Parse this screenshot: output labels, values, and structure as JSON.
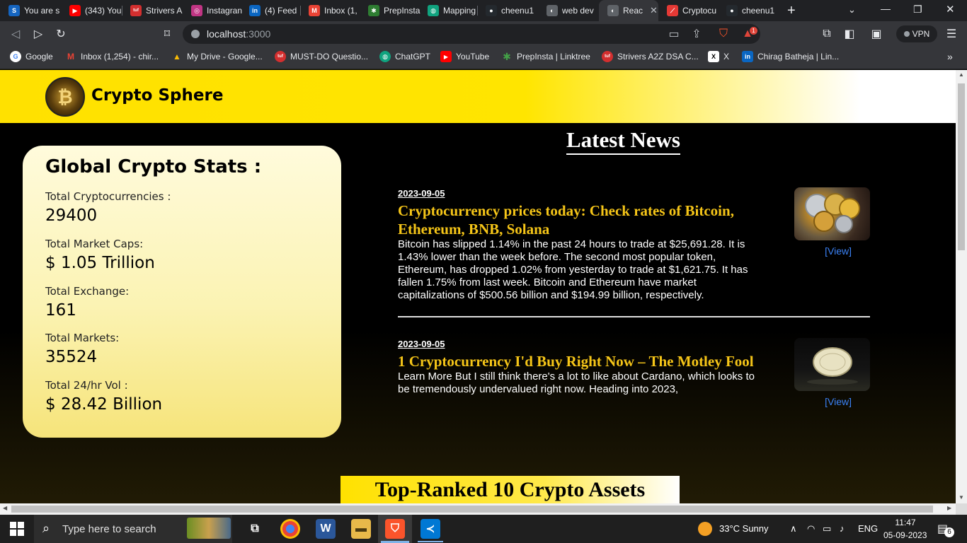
{
  "browser": {
    "tabs": [
      {
        "label": "You are s",
        "icon": "s-icon",
        "color": "#1565c0",
        "glyph": "S"
      },
      {
        "label": "(343) You",
        "icon": "youtube-icon",
        "color": "#ff0000",
        "glyph": "▶"
      },
      {
        "label": "Strivers A",
        "icon": "tuf-icon",
        "color": "#d32f2f",
        "glyph": "tuf"
      },
      {
        "label": "Instagran",
        "icon": "instagram-icon",
        "color": "#c13584",
        "glyph": "◎"
      },
      {
        "label": "(4) Feed",
        "icon": "linkedin-icon",
        "color": "#0a66c2",
        "glyph": "in"
      },
      {
        "label": "Inbox (1,",
        "icon": "gmail-icon",
        "color": "#ea4335",
        "glyph": "M"
      },
      {
        "label": "PrepInsta",
        "icon": "prepinsta-icon",
        "color": "#2e7d32",
        "glyph": "✱"
      },
      {
        "label": "Mapping",
        "icon": "chatgpt-icon",
        "color": "#10a37f",
        "glyph": "◍"
      },
      {
        "label": "cheenu1",
        "icon": "github-icon",
        "color": "#24292e",
        "glyph": "●"
      },
      {
        "label": "web dev",
        "icon": "globe-icon",
        "color": "#5f6368",
        "glyph": "◐"
      },
      {
        "label": "Reac",
        "icon": "globe-icon",
        "color": "#5f6368",
        "glyph": "◐"
      },
      {
        "label": "Cryptocu",
        "icon": "crypto-tab-icon",
        "color": "#e53935",
        "glyph": "⟋"
      },
      {
        "label": "cheenu1",
        "icon": "github-icon",
        "color": "#24292e",
        "glyph": "●"
      }
    ],
    "new_tab": "+",
    "url_host": "localhost",
    "url_port": ":3000",
    "vpn_label": "VPN",
    "brave_badge": "1"
  },
  "bookmarks": [
    {
      "label": "Google",
      "icon": "google-icon",
      "color": "#4285f4",
      "glyph": "G"
    },
    {
      "label": "Inbox (1,254) - chir...",
      "icon": "gmail-icon",
      "color": "#ea4335",
      "glyph": "M"
    },
    {
      "label": "My Drive - Google...",
      "icon": "drive-icon",
      "color": "#fbbc04",
      "glyph": "▲"
    },
    {
      "label": "MUST-DO Questio...",
      "icon": "tuf-icon",
      "color": "#d32f2f",
      "glyph": "tuf"
    },
    {
      "label": "ChatGPT",
      "icon": "chatgpt-icon",
      "color": "#10a37f",
      "glyph": "◍"
    },
    {
      "label": "YouTube",
      "icon": "youtube-icon",
      "color": "#ff0000",
      "glyph": "▶"
    },
    {
      "label": "PrepInsta | Linktree",
      "icon": "prepinsta-icon",
      "color": "#2e7d32",
      "glyph": "✱"
    },
    {
      "label": "Strivers A2Z DSA C...",
      "icon": "tuf-icon",
      "color": "#d32f2f",
      "glyph": "tuf"
    },
    {
      "label": "X",
      "icon": "x-icon",
      "color": "#000000",
      "glyph": "X"
    },
    {
      "label": "Chirag Batheja | Lin...",
      "icon": "linkedin-icon",
      "color": "#0a66c2",
      "glyph": "in"
    }
  ],
  "app": {
    "brand": "Crypto Sphere",
    "logo_glyph": "₿"
  },
  "stats": {
    "title": "Global Crypto Stats :",
    "items": [
      {
        "label": "Total Cryptocurrencies :",
        "value": "29400"
      },
      {
        "label": "Total Market Caps:",
        "value": "$ 1.05 Trillion"
      },
      {
        "label": "Total Exchange:",
        "value": "161"
      },
      {
        "label": "Total Markets:",
        "value": "35524"
      },
      {
        "label": "Total 24/hr Vol :",
        "value": "$ 28.42 Billion"
      }
    ]
  },
  "news": {
    "heading": "Latest News",
    "view_label": "[View]",
    "items": [
      {
        "date": "2023-09-05",
        "title": "Cryptocurrency prices today: Check rates of Bitcoin, Ethereum, BNB, Solana",
        "body": "Bitcoin has slipped 1.14% in the past 24 hours to trade at $25,691.28. It is 1.43% lower than the week before. The second most popular token, Ethereum, has dropped 1.02% from yesterday to trade at $1,621.75. It has fallen 1.75% from last week. Bitcoin and Ethereum have market capitalizations of $500.56 billion and $194.99 billion, respectively."
      },
      {
        "date": "2023-09-05",
        "title": "1 Cryptocurrency I'd Buy Right Now – The Motley Fool",
        "body": "Learn More But I still think there's a lot to like about Cardano, which looks to be tremendously undervalued right now. Heading into 2023,"
      }
    ]
  },
  "top_ranked": {
    "heading": "Top-Ranked 10 Crypto Assets"
  },
  "taskbar": {
    "search_placeholder": "Type here to search",
    "weather": "33°C  Sunny",
    "language": "ENG",
    "time": "11:47",
    "date": "05-09-2023",
    "notifications": "6"
  }
}
